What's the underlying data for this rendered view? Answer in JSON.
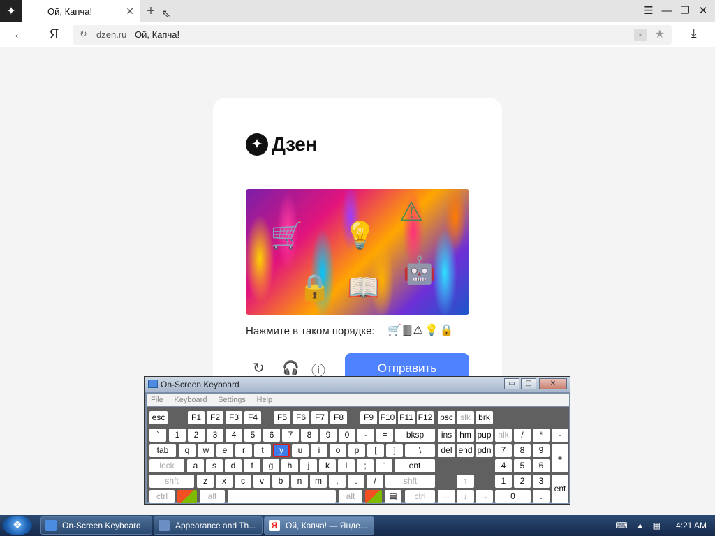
{
  "browser": {
    "tab_title": "Ой, Капча!",
    "tab_close": "✕",
    "new_tab": "+",
    "domain": "dzen.ru",
    "page_title": "Ой, Капча!",
    "yandex_letter": "Я"
  },
  "captcha": {
    "brand": "Дзен",
    "instruction": "Нажмите в таком порядке:",
    "order_icons": "🛒🀫⚠💡🔒",
    "submit_label": "Отправить",
    "image_icons": [
      "cart-icon",
      "lightbulb-icon",
      "warning-triangle-icon",
      "robot-icon",
      "lock-icon",
      "book-icon"
    ]
  },
  "osk": {
    "title": "On-Screen Keyboard",
    "menu": [
      "File",
      "Keyboard",
      "Settings",
      "Help"
    ],
    "buttons": {
      "minimize": "▭",
      "restore": "▢",
      "close": "✕"
    },
    "keys": {
      "esc": "esc",
      "f1": "F1",
      "f2": "F2",
      "f3": "F3",
      "f4": "F4",
      "f5": "F5",
      "f6": "F6",
      "f7": "F7",
      "f8": "F8",
      "f9": "F9",
      "f10": "F10",
      "f11": "F11",
      "f12": "F12",
      "psc": "psc",
      "slk": "slk",
      "brk": "brk",
      "grave": "`",
      "d1": "1",
      "d2": "2",
      "d3": "3",
      "d4": "4",
      "d5": "5",
      "d6": "6",
      "d7": "7",
      "d8": "8",
      "d9": "9",
      "d0": "0",
      "minus": "-",
      "equal": "=",
      "bksp": "bksp",
      "ins": "ins",
      "hm": "hm",
      "pup": "pup",
      "nlk": "nlk",
      "ndiv": "/",
      "nmul": "*",
      "nsub": "-",
      "tab": "tab",
      "q": "q",
      "w": "w",
      "e": "e",
      "r": "r",
      "t": "t",
      "y": "y",
      "u": "u",
      "i": "i",
      "o": "o",
      "p": "p",
      "lbr": "[",
      "rbr": "]",
      "bslash": "\\",
      "del": "del",
      "end": "end",
      "pdn": "pdn",
      "n7": "7",
      "n8": "8",
      "n9": "9",
      "nplus": "+",
      "lock": "lock",
      "a": "a",
      "s": "s",
      "d": "d",
      "f": "f",
      "g": "g",
      "h": "h",
      "j": "j",
      "k": "k",
      "l": "l",
      "semi": ";",
      "quote": "'",
      "ent": "ent",
      "n4": "4",
      "n5": "5",
      "n6": "6",
      "lshft": "shft",
      "z": "z",
      "x": "x",
      "c": "c",
      "v": "v",
      "b": "b",
      "n": "n",
      "m": "m",
      "comma": ",",
      "period": ".",
      "slash": "/",
      "rshft": "shft",
      "up": "↑",
      "n1": "1",
      "n2": "2",
      "n3": "3",
      "nent": "ent",
      "lctrl": "ctrl",
      "lalt": "alt",
      "ralt": "alt",
      "rctrl": "ctrl",
      "left": "←",
      "down": "↓",
      "right": "→",
      "n0": "0",
      "ndot": "."
    }
  },
  "taskbar": {
    "items": [
      "On-Screen Keyboard",
      "Appearance and Th...",
      "Ой, Капча! — Янде..."
    ],
    "time": "4:21 AM"
  },
  "colors": {
    "submit": "#4e82ff",
    "selected_key": "#3c7be8",
    "selected_outline": "#d81e1e"
  }
}
